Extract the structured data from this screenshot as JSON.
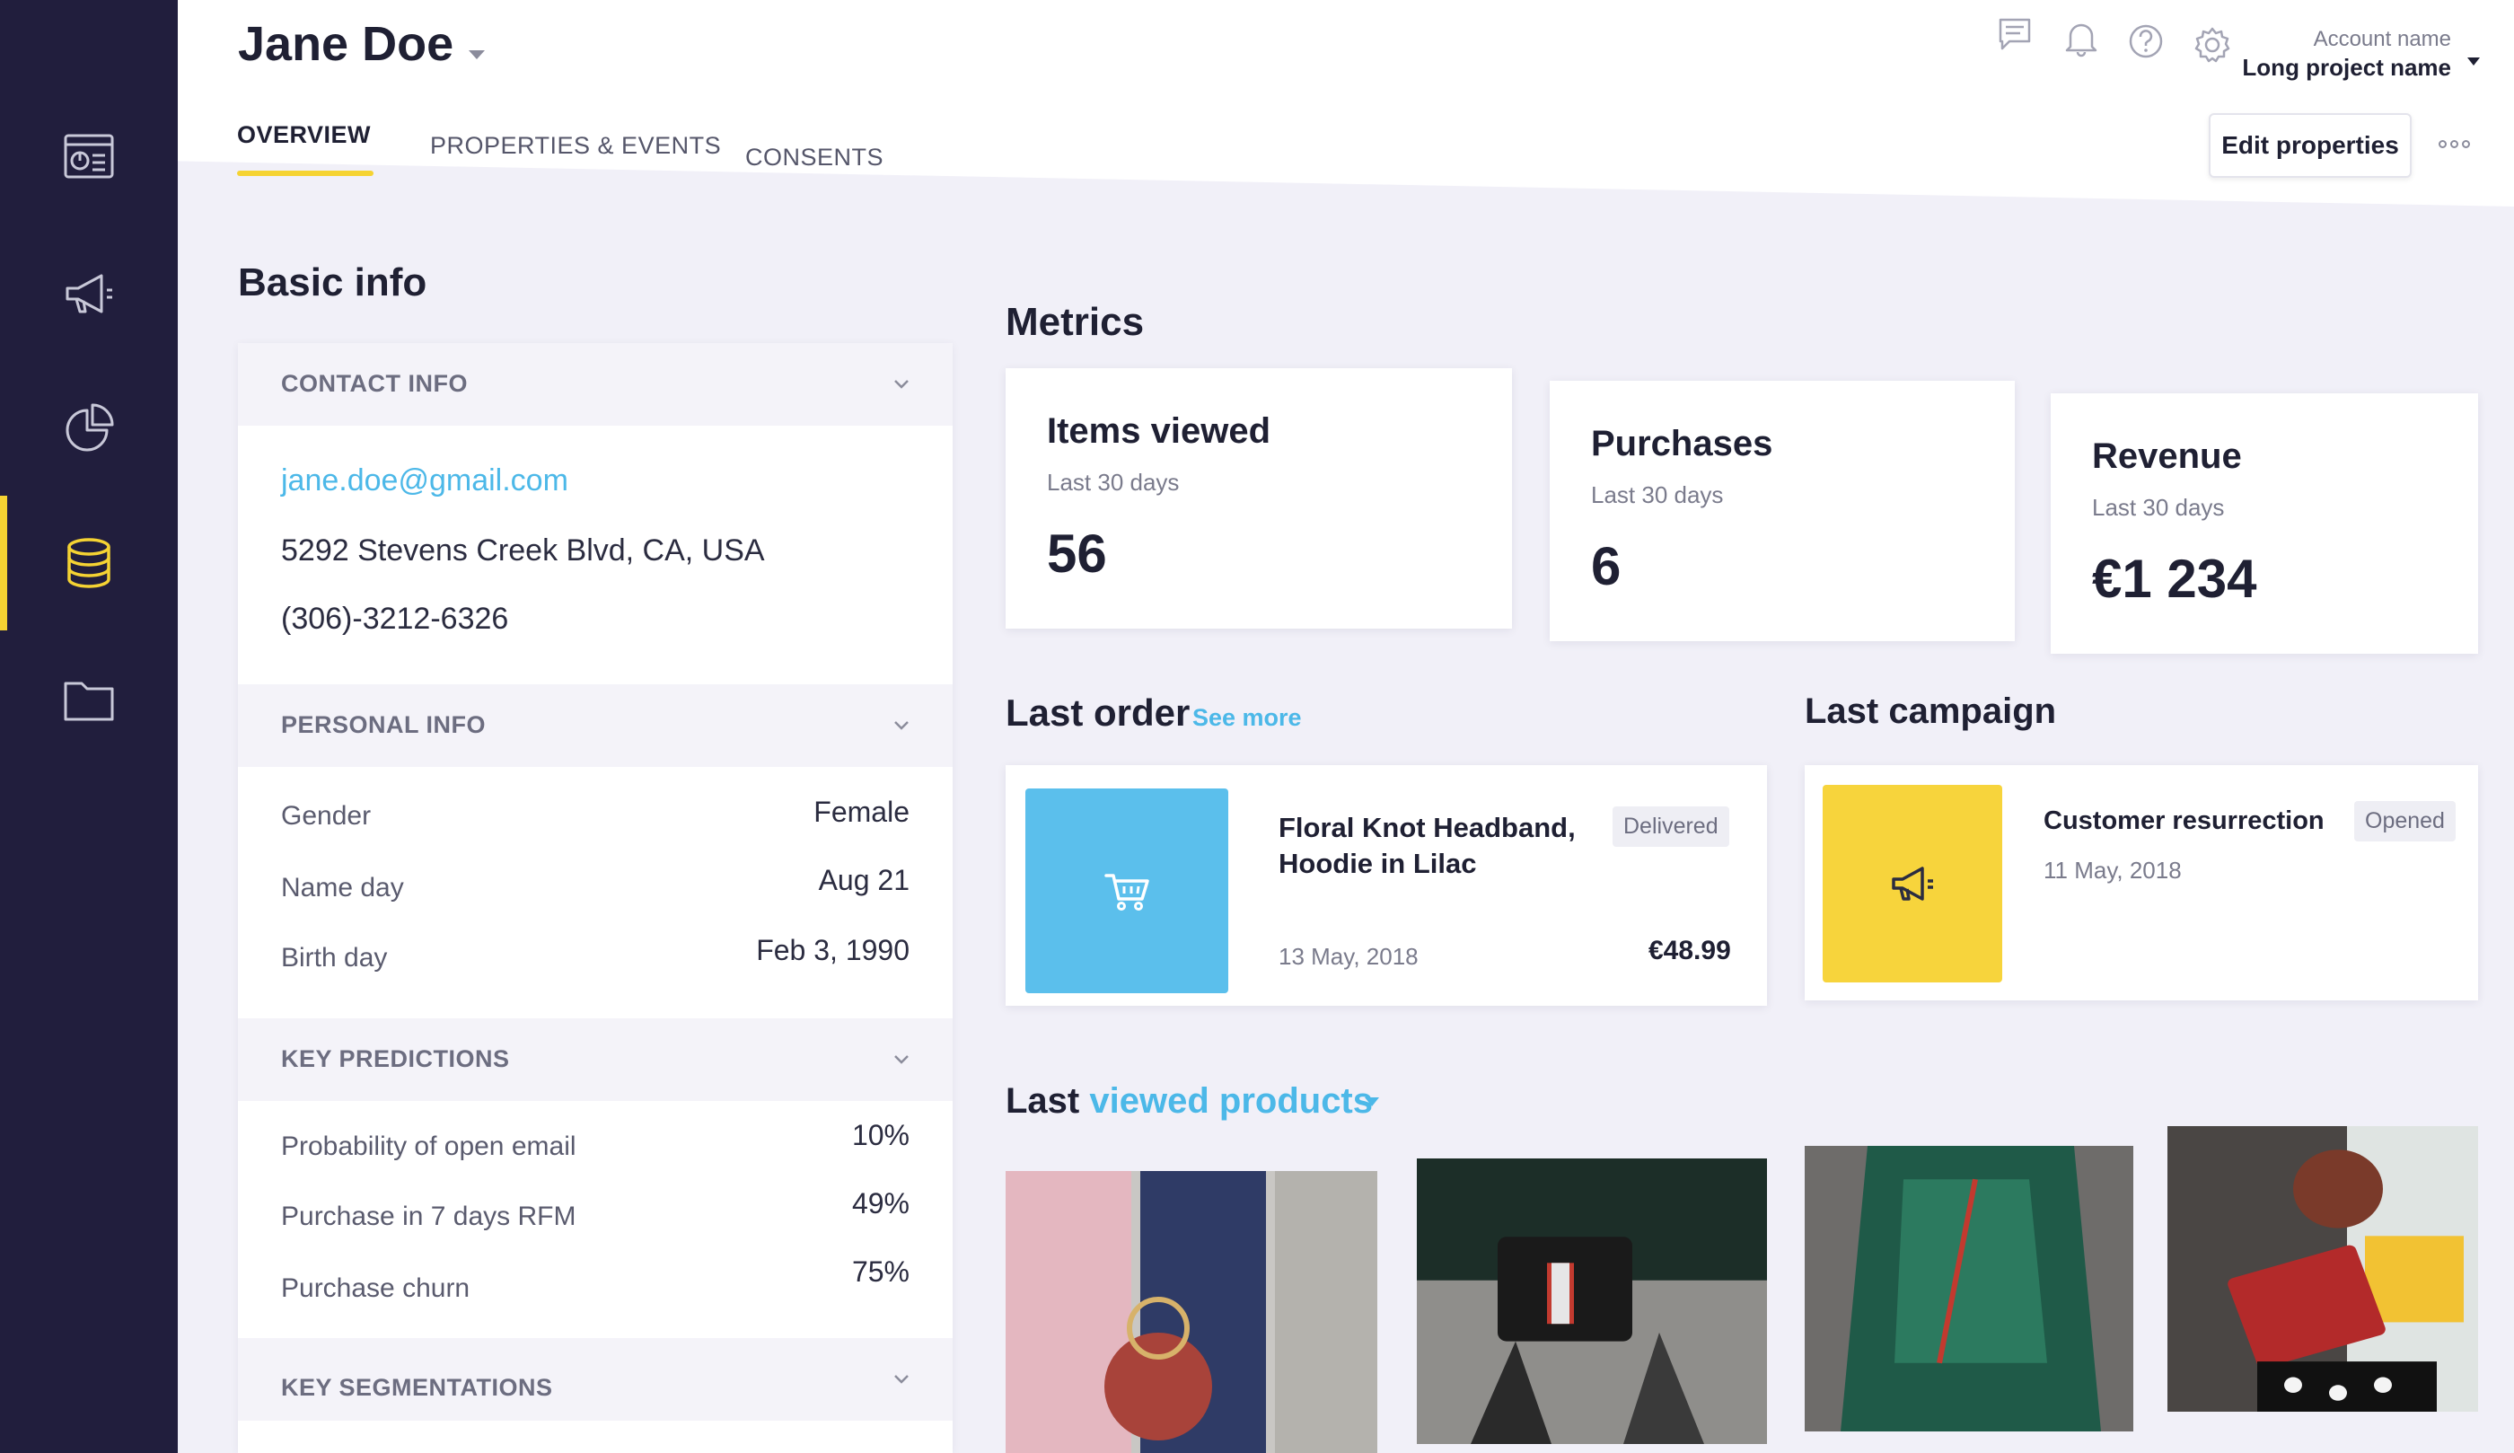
{
  "sidebar": {
    "items": [
      {
        "icon": "dashboard-icon",
        "active": false
      },
      {
        "icon": "megaphone-icon",
        "active": false
      },
      {
        "icon": "pie-chart-icon",
        "active": false
      },
      {
        "icon": "database-icon",
        "active": true
      },
      {
        "icon": "folder-icon",
        "active": false
      }
    ]
  },
  "header": {
    "user_name": "Jane Doe",
    "tabs": [
      {
        "label": "OVERVIEW",
        "active": true
      },
      {
        "label": "PROPERTIES & EVENTS",
        "active": false
      },
      {
        "label": "CONSENTS",
        "active": false
      }
    ],
    "account_label": "Account name",
    "account_value": "Long project name",
    "edit_button": "Edit properties",
    "icons": [
      "chat-icon",
      "bell-icon",
      "help-icon",
      "settings-icon",
      "more-options-icon"
    ]
  },
  "basic_info": {
    "title": "Basic info",
    "contact": {
      "label": "CONTACT INFO",
      "email": "jane.doe@gmail.com",
      "address": "5292 Stevens Creek Blvd, CA, USA",
      "phone": "(306)-3212-6326"
    },
    "personal": {
      "label": "PERSONAL INFO",
      "rows": [
        {
          "label": "Gender",
          "value": "Female"
        },
        {
          "label": "Name day",
          "value": "Aug 21"
        },
        {
          "label": "Birth day",
          "value": "Feb 3, 1990"
        }
      ]
    },
    "predictions": {
      "label": "KEY PREDICTIONS",
      "rows": [
        {
          "label": "Probability of open email",
          "value": "10%"
        },
        {
          "label": "Purchase in 7 days RFM",
          "value": "49%"
        },
        {
          "label": "Purchase churn",
          "value": "75%"
        }
      ]
    },
    "segmentations": {
      "label": "KEY SEGMENTATIONS"
    }
  },
  "metrics": {
    "title": "Metrics",
    "cards": [
      {
        "title": "Items viewed",
        "period": "Last 30 days",
        "value": "56"
      },
      {
        "title": "Purchases",
        "period": "Last 30 days",
        "value": "6"
      },
      {
        "title": "Revenue",
        "period": "Last 30 days",
        "value": "€1 234"
      }
    ]
  },
  "last_order": {
    "title": "Last order",
    "see_more": "See more",
    "name_line1": "Floral Knot Headband,",
    "name_line2": "Hoodie in Lilac",
    "status": "Delivered",
    "date": "13 May, 2018",
    "price": "€48.99",
    "thumb_color": "#5bbfec"
  },
  "last_campaign": {
    "title": "Last campaign",
    "name": "Customer resurrection",
    "status": "Opened",
    "date": "11 May, 2018",
    "thumb_color": "#f7d43c"
  },
  "last_viewed": {
    "prefix": "Last",
    "accent": "viewed products"
  },
  "colors": {
    "accent_yellow": "#f5d333",
    "accent_blue": "#4cb8e8",
    "sidebar_bg": "#211e3d"
  }
}
